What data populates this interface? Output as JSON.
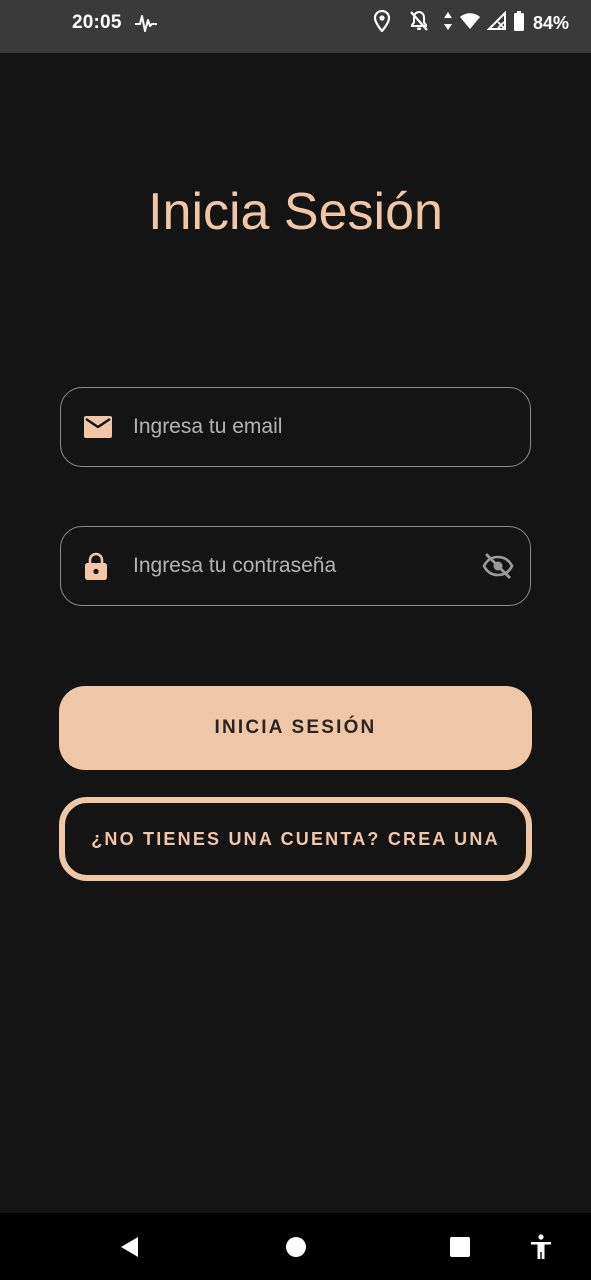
{
  "status_bar": {
    "time": "20:05",
    "battery": "84%",
    "icons": [
      "pulse-icon",
      "location-icon",
      "notifications-off-icon",
      "data-arrows-icon",
      "wifi-icon",
      "signal-icon",
      "battery-icon"
    ]
  },
  "login": {
    "title": "Inicia Sesión",
    "email_placeholder": "Ingresa tu email",
    "email_value": "",
    "password_placeholder": "Ingresa tu contraseña",
    "password_value": "",
    "login_button": "INICIA SESIÓN",
    "signup_button": "¿NO TIENES UNA CUENTA? CREA UNA"
  },
  "nav_bar": {
    "icons": [
      "back-icon",
      "home-icon",
      "recents-icon",
      "accessibility-icon"
    ]
  },
  "colors": {
    "background": "#141414",
    "accent": "#f0c7a6",
    "status_bar": "#3a3a3a",
    "field_border": "#8c8c8c"
  }
}
